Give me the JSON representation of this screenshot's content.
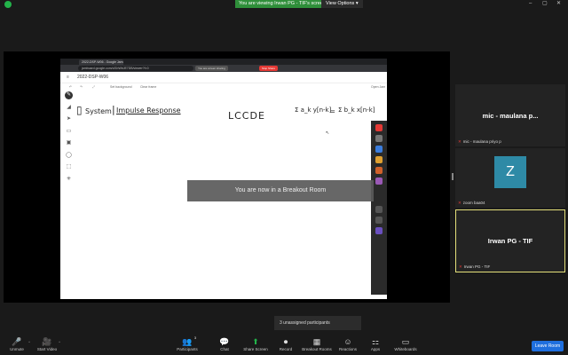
{
  "banner": {
    "viewing_text": "You are viewing Irwan PG - TIF's screen",
    "view_options": "View Options",
    "view_options_caret": "▾"
  },
  "window_controls": {
    "minimize": "–",
    "maximize": "▢",
    "close": "✕"
  },
  "browser": {
    "tab_title": "2022-DSP-W06 - Google Jam...",
    "url": "jamboard.google.com/d/1bWbJE7DB/viewer?f=0",
    "share_pill": "You are screen sharing",
    "stop_share": "Stop Share"
  },
  "jamboard": {
    "doc_title": "2022-DSP-W06",
    "menu_icon": "≡",
    "toolbar": {
      "undo": "↶",
      "redo": "↷",
      "zoom": "⤢",
      "set_background": "Set background",
      "clear_frame": "Clear frame",
      "open_label": "Open Jam"
    },
    "handwriting": {
      "system": "System",
      "impulse": "Impulse Response",
      "lccde": "LCCDE",
      "equation_left": "Σ a_k y[n-k]",
      "equation_right": "Σ b_k x[n-k]",
      "plus": "="
    },
    "left_tools": [
      "✎",
      "◢",
      "➤",
      "▭",
      "▣",
      "◯",
      "⬚",
      "✳"
    ]
  },
  "breakout_overlay": "You are now in a Breakout Room",
  "participants": [
    {
      "name": "mic - maulana p...",
      "caption": "mic - maulana priyo p",
      "mic_icon": "✕"
    },
    {
      "avatar_letter": "Z",
      "caption": "zoom baa04",
      "mic_icon": "✕"
    },
    {
      "name": "Irwan PG - TIF",
      "caption": "Irwan PG - TIF",
      "mic_icon": "✕"
    }
  ],
  "unassigned": "3 unassigned participants",
  "bottom_bar": {
    "unmute": "Unmute",
    "start_video": "Start Video",
    "participants": "Participants",
    "participants_count": "3",
    "chat": "Chat",
    "share_screen": "Share Screen",
    "record": "Record",
    "breakout_rooms": "Breakout Rooms",
    "reactions": "Reactions",
    "apps": "Apps",
    "whiteboards": "Whiteboards",
    "leave_room": "Leave Room",
    "icons": {
      "unmute": "🎤",
      "start_video": "🎥",
      "participants": "👥",
      "chat": "💬",
      "share_screen": "⬆",
      "record": "⏺",
      "breakout_rooms": "▦",
      "reactions": "☺",
      "apps": "⚏",
      "whiteboards": "▭",
      "caret": "^"
    }
  }
}
